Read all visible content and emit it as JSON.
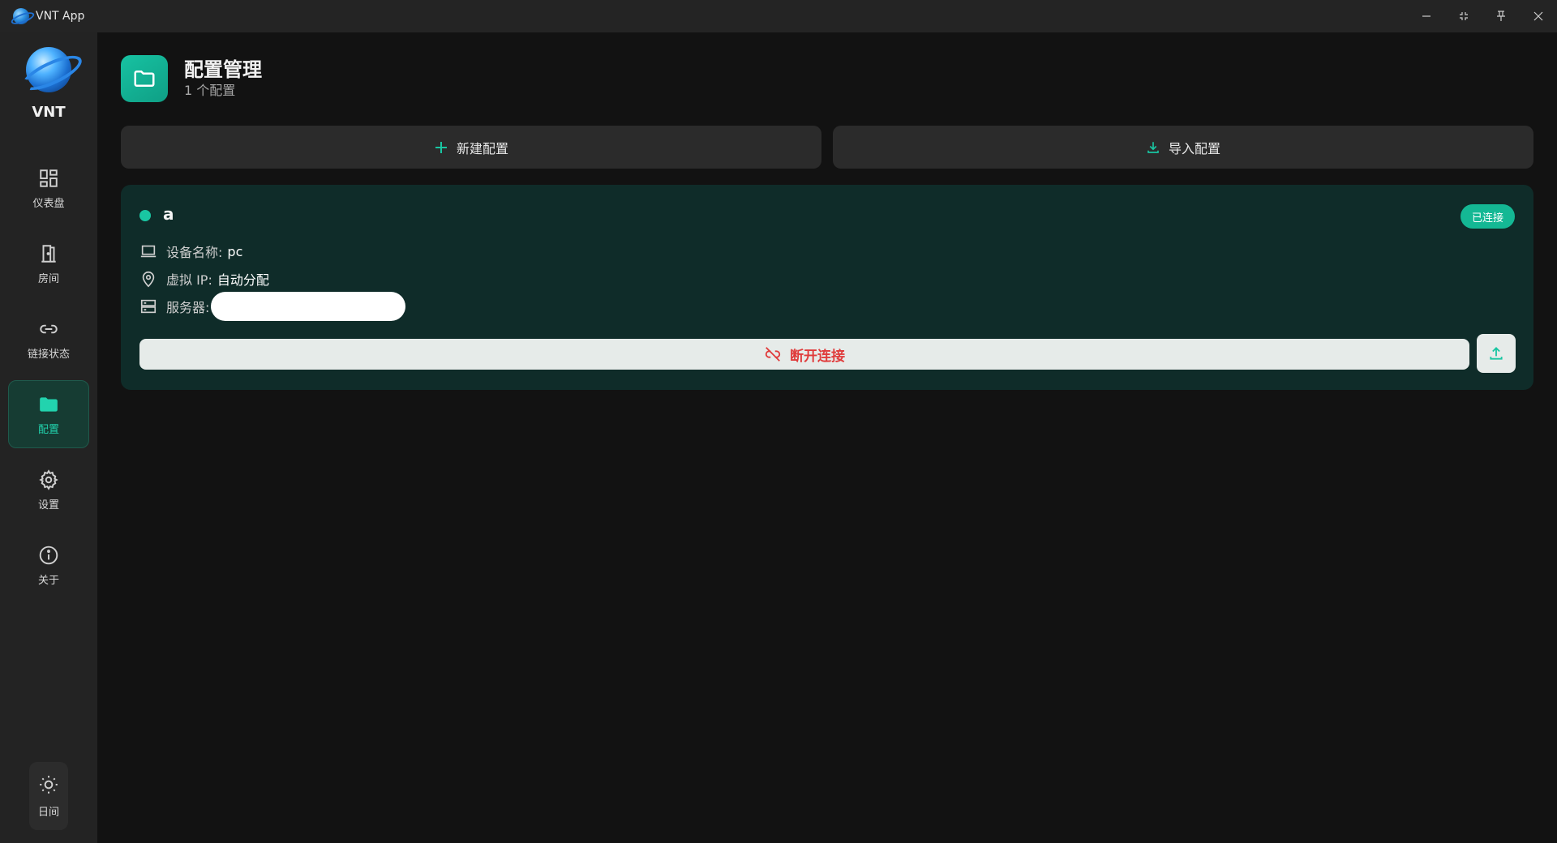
{
  "window": {
    "title": "VNT App",
    "controls": {
      "minimize": "–",
      "restore": "⠿",
      "pin": "⊤",
      "close": "✕"
    }
  },
  "sidebar": {
    "brand_name": "VNT",
    "items": [
      {
        "label": "仪表盘",
        "icon": "dashboard-icon",
        "active": false
      },
      {
        "label": "房间",
        "icon": "door-icon",
        "active": false
      },
      {
        "label": "链接状态",
        "icon": "link-icon",
        "active": false
      },
      {
        "label": "配置",
        "icon": "folder-icon",
        "active": true
      },
      {
        "label": "设置",
        "icon": "gear-icon",
        "active": false
      },
      {
        "label": "关于",
        "icon": "info-icon",
        "active": false
      }
    ],
    "theme_toggle_label": "日间"
  },
  "header": {
    "title": "配置管理",
    "subtitle": "1 个配置"
  },
  "actions": {
    "new_label": "新建配置",
    "import_label": "导入配置"
  },
  "config": {
    "name": "a",
    "status": "已连接",
    "device_label": "设备名称:",
    "device_value": "pc",
    "ip_label": "虚拟 IP:",
    "ip_value": "自动分配",
    "server_label": "服务器:",
    "disconnect_label": "断开连接"
  },
  "colors": {
    "accent": "#19c6a2",
    "danger": "#e03b3b",
    "card_bg": "#0f2c29"
  }
}
